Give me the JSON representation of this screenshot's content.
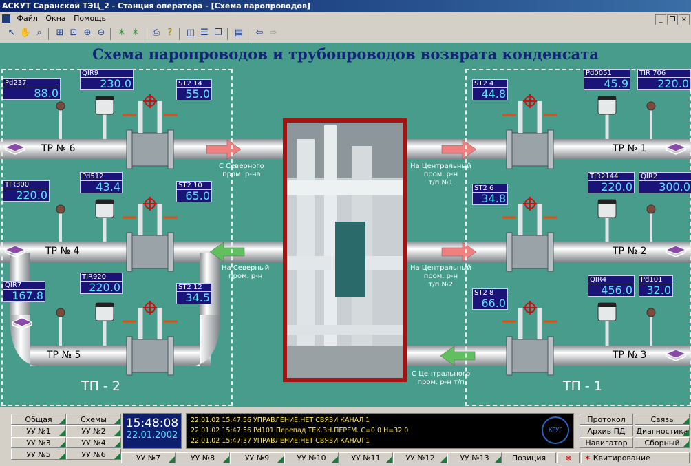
{
  "window": {
    "title": "АСКУТ Саранской ТЭЦ_2 - Станция оператора - [Схема паропроводов]",
    "minimize": "_",
    "restore": "❐",
    "close": "×"
  },
  "menu": [
    "Файл",
    "Окна",
    "Помощь"
  ],
  "schema": {
    "title": "Схема паропроводов и трубопроводов возврата конденсата",
    "zones": [
      "ТП - 2",
      "ТП - 1"
    ],
    "pipes": [
      "ТР № 6",
      "ТР № 4",
      "ТР № 5",
      "ТР № 1",
      "ТР № 2",
      "ТР № 3"
    ],
    "flows": [
      [
        "С Северного",
        "пром. р-на"
      ],
      [
        "На Северный",
        "пром. р-н"
      ],
      [
        "На Центральный",
        "пром. р-н",
        "т/п №1"
      ],
      [
        "На Центральный",
        "пром. р-н",
        "т/п №2"
      ],
      [
        "С Центрального",
        "пром. р-н т/п"
      ]
    ],
    "sensors": [
      {
        "tag": "Pd237",
        "value": "88.0"
      },
      {
        "tag": "QIR9",
        "value": "230.0"
      },
      {
        "tag": "ST2 14",
        "value": "55.0"
      },
      {
        "tag": "TIR300",
        "value": "220.0"
      },
      {
        "tag": "Pd512",
        "value": "43.4"
      },
      {
        "tag": "ST2 10",
        "value": "65.0"
      },
      {
        "tag": "QIR7",
        "value": "167.8"
      },
      {
        "tag": "TIR920",
        "value": "220.0"
      },
      {
        "tag": "ST2 12",
        "value": "34.5"
      },
      {
        "tag": "ST2 4",
        "value": "44.8"
      },
      {
        "tag": "Pd0051",
        "value": "45.9"
      },
      {
        "tag": "TIR 706",
        "value": "220.0"
      },
      {
        "tag": "ST2 6",
        "value": "34.8"
      },
      {
        "tag": "TIR2144",
        "value": "220.0"
      },
      {
        "tag": "QIR2",
        "value": "300.0"
      },
      {
        "tag": "ST2 8",
        "value": "66.0"
      },
      {
        "tag": "QIR4",
        "value": "456.0"
      },
      {
        "tag": "Pd101",
        "value": "32.0"
      }
    ]
  },
  "status": {
    "left_buttons": [
      "Общая",
      "Схемы",
      "УУ №1",
      "УУ №2",
      "УУ №3",
      "УУ №4",
      "УУ №5",
      "УУ №6"
    ],
    "bottom_buttons": [
      "УУ №7",
      "УУ №8",
      "УУ №9",
      "УУ №10",
      "УУ №11",
      "УУ №12",
      "УУ №13",
      "Позиция"
    ],
    "right_buttons": [
      "Протокол",
      "Связь",
      "Архив ПД",
      "Диагностика",
      "Навигатор",
      "Сборный"
    ],
    "ack": "Квитирование",
    "time": "15:48:08",
    "date": "22.01.2002",
    "messages": [
      "22.01.02 15:47:56  УПРАВЛЕНИЕ:НЕТ СВЯЗИ КАНАЛ 1",
      "22.01.02 15:47:56  Pd101 Перепад          ТЕК.ЗН.ПЕРЕМ.  C=0.0 H=32.0",
      "22.01.02 15:47:37  УПРАВЛЕНИЕ:НЕТ СВЯЗИ КАНАЛ 1"
    ],
    "logo_text": "КРУГ"
  },
  "colors": {
    "canvas": "#489c8c",
    "tag_bg": "#1a1478",
    "value_text": "#5ae7ff",
    "title": "#12257a"
  }
}
